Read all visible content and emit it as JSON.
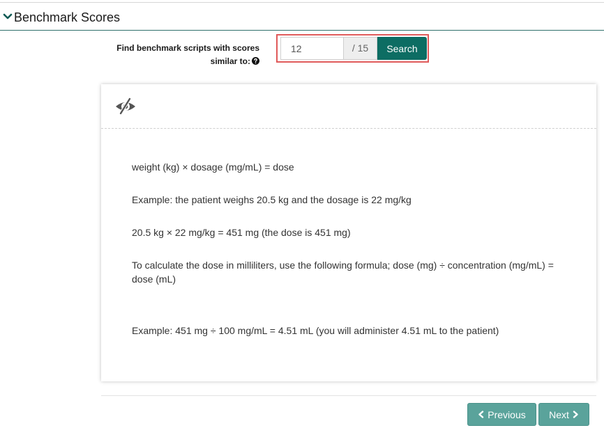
{
  "section": {
    "title": "Benchmark Scores",
    "icon": "chevron-down-icon"
  },
  "search": {
    "label_line1": "Find benchmark scripts with scores",
    "label_line2": "similar to:",
    "help_icon": "question-circle-icon",
    "score_value": "12",
    "score_max": "/ 15",
    "button_label": "Search",
    "button_color": "#0d6d63",
    "highlight_color": "#e05a5a"
  },
  "card": {
    "icon": "eye-slash-icon",
    "paragraphs": [
      "weight (kg) × dosage (mg/mL) = dose",
      "Example: the patient weighs 20.5 kg and the dosage is 22 mg/kg",
      "20.5 kg × 22 mg/kg = 451 mg (the dose is 451 mg)",
      "To calculate the dose in milliliters, use the following formula; dose (mg) ÷ concentration (mg/mL) = dose (mL)",
      "Example: 451 mg ÷ 100 mg/mL = 4.51 mL (you will administer 4.51 mL to the patient)"
    ]
  },
  "navigation": {
    "previous_label": "Previous",
    "next_label": "Next",
    "button_color": "#5aa39b"
  }
}
